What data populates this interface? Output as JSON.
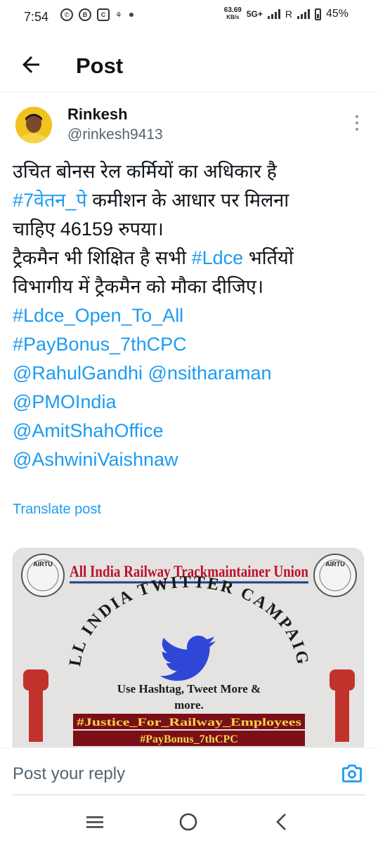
{
  "status_bar": {
    "time": "7:54",
    "speed_value": "63.69",
    "speed_unit": "KB/s",
    "network": "5G+",
    "roaming": "R",
    "battery": "45%"
  },
  "header": {
    "title": "Post",
    "back_icon": "arrow-left-icon"
  },
  "post": {
    "author_name": "Rinkesh",
    "author_handle": "@rinkesh9413",
    "line1": "उचित बोनस रेल कर्मियों का अधिकार है",
    "tag_7vetan": "#7वेतन_पे",
    "line2_rest": " कमीशन के आधार पर मिलना",
    "line3": "चाहिए 46159 रुपया।",
    "line4_a": "ट्रैकमैन भी शिक्षित है सभी ",
    "tag_ldce": "#Ldce",
    "line4_b": " भर्तियों",
    "line5": "विभागीय में ट्रैकमैन को मौका दीजिए।",
    "tag_ldce_open": "#Ldce_Open_To_All",
    "tag_paybonus": "#PayBonus_7thCPC",
    "mention_rahul": "@RahulGandhi",
    "mention_nsi": "@nsitharaman",
    "mention_pmo": "@PMOIndia",
    "mention_amit": "@AmitShahOffice",
    "mention_ashwini": "@AshwiniVaishnaw",
    "translate": "Translate post"
  },
  "media": {
    "banner_title": "All India Railway Trackmaintainer Union",
    "logo_text": "AIRTU",
    "campaign_arc": "ALL INDIA TWITTER CAMPAIGN",
    "instruction_line1": "Use Hashtag, Tweet More &",
    "instruction_line2": "more.",
    "hashtag1": "#Justice_For_Railway_Employees",
    "hashtag2": "#PayBonus_7thCPC"
  },
  "reply": {
    "placeholder": "Post your reply",
    "camera_icon": "camera-icon"
  },
  "colors": {
    "link": "#1d9bf0",
    "text": "#0f1419",
    "secondary": "#536471"
  }
}
